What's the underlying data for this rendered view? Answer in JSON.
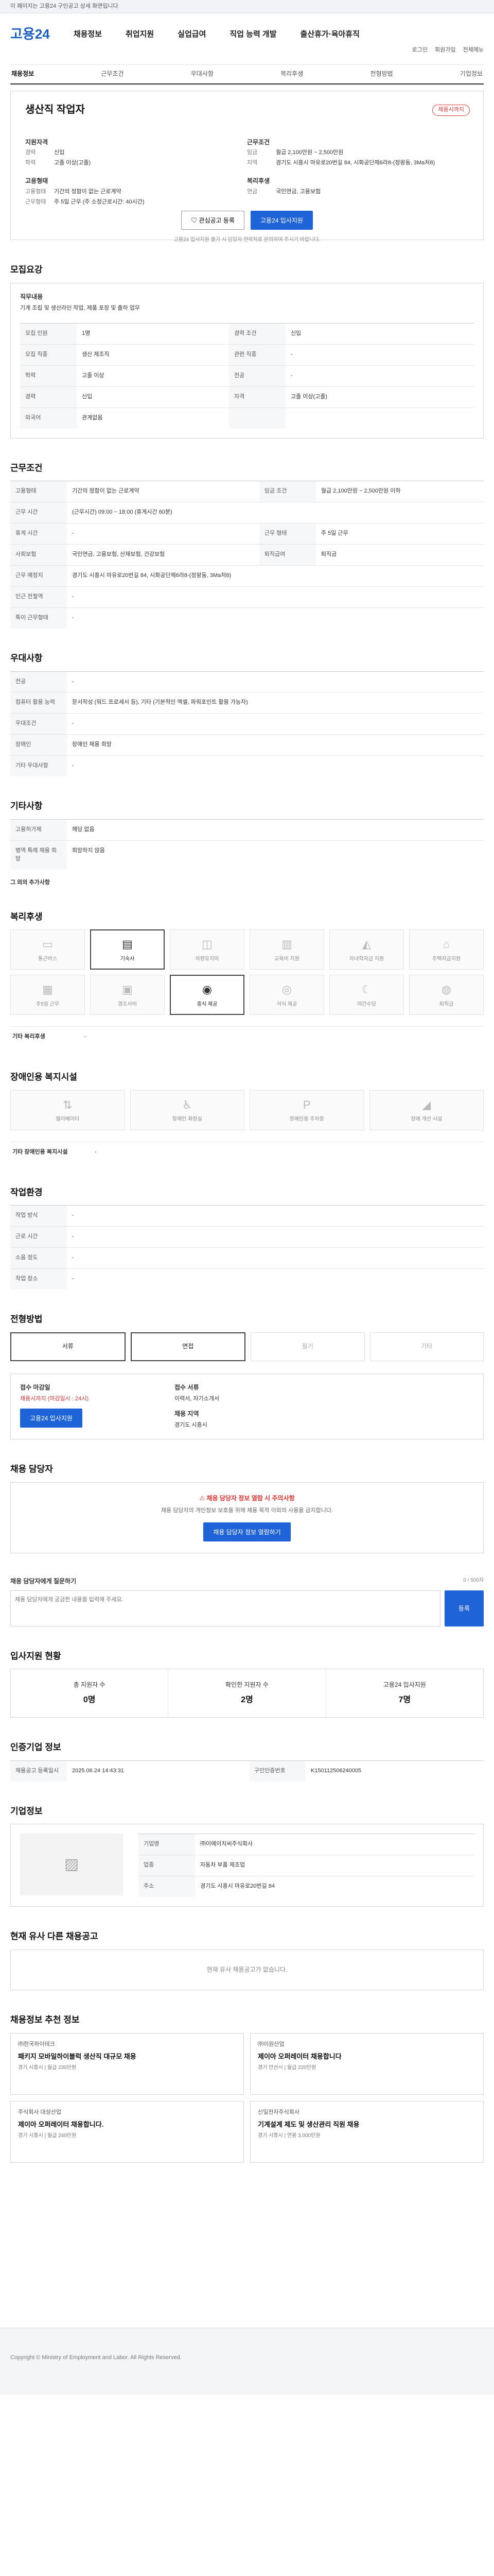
{
  "topbar": {
    "notice": "이 페이지는 고용24 구인공고 상세 화면입니다"
  },
  "header": {
    "logo_text": "고용24",
    "util": [
      "로그인",
      "회원가입",
      "전체메뉴"
    ],
    "gnb": [
      "채용정보",
      "취업지원",
      "실업급여",
      "직업 능력 개발",
      "출산휴가·육아휴직"
    ]
  },
  "tabs": [
    "채용정보",
    "근무조건",
    "우대사항",
    "복리후생",
    "전형방법",
    "기업정보"
  ],
  "summary": {
    "title": "생산직 작업자",
    "badge": "채용시까지",
    "left_head": "지원자격",
    "left": [
      {
        "k": "경력",
        "v": "신입"
      },
      {
        "k": "학력",
        "v": "고졸 이상(고졸)"
      }
    ],
    "right_head": "근무조건",
    "right": [
      {
        "k": "임금",
        "v": "월급 2,100만원 ~ 2,500만원"
      },
      {
        "k": "지역",
        "v": "경기도 시흥시 마유로20번길 84, 시화공단제6라8-(정왕동, 3Ma처8)"
      }
    ],
    "left2_head": "고용형태",
    "left2": [
      {
        "k": "고용형태",
        "v": "기간의 정함이 없는 근로계약"
      },
      {
        "k": "근무형태",
        "v": "주 5일 근무 (주 소정근로시간: 40시간)"
      }
    ],
    "right2_head": "복리후생",
    "right2": [
      {
        "k": "연금",
        "v": "국민연금, 고용보험"
      }
    ],
    "btn_fav": "관심공고 등록",
    "btn_apply": "고용24 입사지원",
    "note": "고용24 입사지원 불가 시 담당자 연락처로 문의하여 주시기 바랍니다."
  },
  "recruit": {
    "title": "모집요강",
    "job_head": "직무내용",
    "job_text": "기계 조립 및 생산라인 작업, 제품 포장 및 출하 업무",
    "rows": [
      {
        "k": "모집 인원",
        "v": "1명",
        "k2": "경력 조건",
        "v2": "신입"
      },
      {
        "k": "모집 직종",
        "v": "생산 제조직",
        "k2": "관련 직종",
        "v2": "-"
      },
      {
        "k": "학력",
        "v": "고졸 이상",
        "k2": "전공",
        "v2": "-"
      },
      {
        "k": "경력",
        "v": "신입",
        "k2": "자격",
        "v2": "고졸 이상(고졸)"
      },
      {
        "k": "외국어",
        "v": "관계없음",
        "k2": "",
        "v2": ""
      }
    ]
  },
  "conditions": {
    "title": "근무조건",
    "rows": [
      {
        "k": "고용형태",
        "v": "기간의 정함이 없는 근로계약",
        "k2": "임금 조건",
        "v2": "월급 2,100만원 ~ 2,500만원 이하"
      },
      {
        "k": "근무 시간",
        "v": "(근무시간) 09:00 ~ 18:00 (휴게시간 60분)",
        "k2": "",
        "v2": ""
      },
      {
        "k": "휴게 시간",
        "v": "-",
        "k2": "근무 형태",
        "v2": "주 5일 근무"
      },
      {
        "k": "사회보험",
        "v": "국민연금, 고용보험, 산재보험, 건강보험",
        "k2": "퇴직급여",
        "v2": "퇴직금"
      },
      {
        "k": "근무 예정지",
        "v": "경기도 시흥시 마유로20번길 84, 시화공단제6라8-(정왕동, 3Ma처8)",
        "k2": "",
        "v2": ""
      },
      {
        "k": "인근 전철역",
        "v": "-",
        "k2": "",
        "v2": ""
      },
      {
        "k": "특이 근무형태",
        "v": "-",
        "k2": "",
        "v2": ""
      }
    ]
  },
  "prefer": {
    "title": "우대사항",
    "rows": [
      {
        "k": "전공",
        "v": "-"
      },
      {
        "k": "컴퓨터 활용 능력",
        "v": "문서작성 (워드 프로세서 등), 기타 (기본적인 엑셀, 파워포인트 활용 가능자)"
      },
      {
        "k": "우대조건",
        "v": "-"
      },
      {
        "k": "장애인",
        "v": "장애인 채용 희망"
      },
      {
        "k": "기타 우대사항",
        "v": "-"
      }
    ]
  },
  "etc": {
    "title": "기타사항",
    "rows": [
      {
        "k": "고용허가제",
        "v": "해당 없음"
      },
      {
        "k": "병역 특례 채용 희망",
        "v": "희망하지 않음"
      }
    ],
    "more": "그 외의 추가사항"
  },
  "welfare": {
    "title": "복리후생",
    "items": [
      {
        "label": "통근버스",
        "on": false
      },
      {
        "label": "기숙사",
        "on": true
      },
      {
        "label": "차량유지비",
        "on": false
      },
      {
        "label": "교육비 지원",
        "on": false
      },
      {
        "label": "자녀학자금 지원",
        "on": false
      },
      {
        "label": "주택자금지원",
        "on": false
      },
      {
        "label": "주5일 근무",
        "on": false
      },
      {
        "label": "경조사비",
        "on": false
      },
      {
        "label": "중식 제공",
        "on": true
      },
      {
        "label": "석식 제공",
        "on": false
      },
      {
        "label": "야간수당",
        "on": false
      },
      {
        "label": "퇴직금",
        "on": false
      }
    ],
    "other_label": "기타 복리후생",
    "other_val": "-"
  },
  "disabled": {
    "title": "장애인용 복지시설",
    "items": [
      "엘리베이터",
      "장애인 화장실",
      "장애인용 주차장",
      "장애 개선 시설"
    ],
    "other_label": "기타 장애인용 복지시설",
    "other_val": "-"
  },
  "env": {
    "title": "작업환경",
    "rows": [
      {
        "k": "작업 방식",
        "v": "-"
      },
      {
        "k": "근로 시간",
        "v": "-"
      },
      {
        "k": "소음 정도",
        "v": "-"
      },
      {
        "k": "작업 장소",
        "v": "-"
      }
    ]
  },
  "process": {
    "title": "전형방법",
    "methods": [
      {
        "label": "서류",
        "on": true
      },
      {
        "label": "면접",
        "on": true
      },
      {
        "label": "필기",
        "on": false
      },
      {
        "label": "기타",
        "on": false
      }
    ],
    "receipt_head": "접수 마감일",
    "receipt_val": "채용시까지 (마감일시 : 24시)",
    "receipt_btn": "고용24 입사지원",
    "docs_head": "접수 서류",
    "docs_val": "이력서, 자기소개서",
    "area_head": "채용 지역",
    "area_val": "경기도 시흥시"
  },
  "contact": {
    "title": "채용 담당자",
    "notice": "채용 담당자 정보 열람 시 주의사항",
    "text": "채용 담당자의 개인정보 보호를 위해 채용 목적 이외의 사용을 금지합니다.",
    "btn": "채용 담당자 정보 열람하기"
  },
  "qna": {
    "title": "채용 담당자에게 질문하기",
    "placeholder": "채용 담당자에게 궁금한 내용을 입력해 주세요.",
    "count": "0 / 500자",
    "btn": "등록"
  },
  "status": {
    "title": "입사지원 현황",
    "items": [
      {
        "label": "총 지원자 수",
        "val": "0명"
      },
      {
        "label": "확인한 지원자 수",
        "val": "2명"
      },
      {
        "label": "고용24 입사지원",
        "val": "7명"
      }
    ]
  },
  "manage": {
    "title": "인증기업 정보",
    "rows": [
      {
        "k": "채용공고 등록일시",
        "v": "2025.06.24 14:43:31"
      },
      {
        "k": "구인인증번호",
        "v": "K150112506240005"
      }
    ]
  },
  "company": {
    "title": "기업정보",
    "rows": [
      {
        "k": "기업명",
        "v": "㈜이에이치씨주식회사"
      },
      {
        "k": "업종",
        "v": "자동차 부품 제조업"
      },
      {
        "k": "주소",
        "v": "경기도 시흥시 마유로20번길 84"
      }
    ]
  },
  "similar": {
    "title": "현재 유사 다른 채용공고",
    "empty": "현재 유사 채용공고가 없습니다."
  },
  "recommend": {
    "title": "채용정보 추천 정보",
    "cards": [
      {
        "org": "㈜한국하이테크",
        "title": "패키지 모바일하이블럭 생산직 대규모 채용",
        "meta": "경기 시흥시 | 월급 230만원"
      },
      {
        "org": "㈜이원산업",
        "title": "제이아 오퍼레이터 채용합니다",
        "meta": "경기 안산시 | 월급 220만원"
      },
      {
        "org": "주식회사 대성산업",
        "title": "제이아 오퍼레이터 채용합니다.",
        "meta": "경기 시흥시 | 월급 240만원"
      },
      {
        "org": "신일전자주식회사",
        "title": "기계설계 제도 및 생산관리 직원 채용",
        "meta": "경기 시흥시 | 연봉 3,000만원"
      }
    ]
  },
  "footer": {
    "copy": "Copyright © Ministry of Employment and Labor. All Rights Reserved."
  }
}
